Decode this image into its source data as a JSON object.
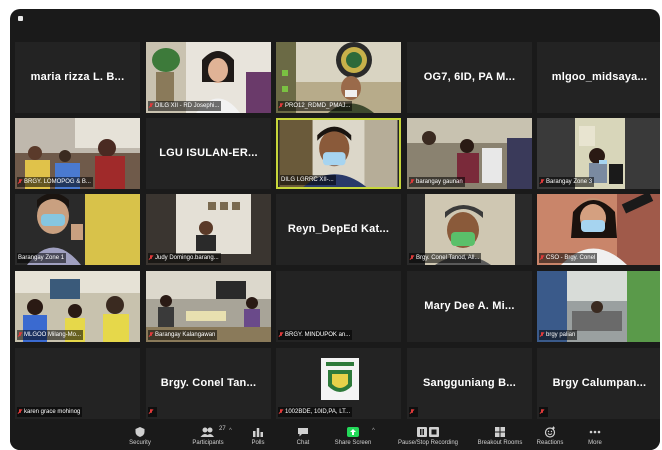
{
  "toolbar": {
    "security": "Security",
    "participants": "Participants",
    "participants_count": "27",
    "polls": "Polls",
    "chat": "Chat",
    "share_screen": "Share Screen",
    "stop_recording": "Pause/Stop Recording",
    "breakout": "Breakout Rooms",
    "reactions": "Reactions",
    "more": "More"
  },
  "tiles": [
    {
      "name": "maria rizza L. B...",
      "label": ""
    },
    {
      "name": "",
      "label": "DILG XII - RD Josephi..."
    },
    {
      "name": "",
      "label": "PRO12_RDMD_PMAJ..."
    },
    {
      "name": "OG7, 6ID, PA M...",
      "label": ""
    },
    {
      "name": "mlgoo_midsaya...",
      "label": ""
    },
    {
      "name": "",
      "label": "BRGY. LOMOPOG & B..."
    },
    {
      "name": "LGU ISULAN-ER...",
      "label": ""
    },
    {
      "name": "",
      "label": "DILG LGRRC XII-..."
    },
    {
      "name": "",
      "label": "barangay gaunan"
    },
    {
      "name": "",
      "label": "Barangay Zone 3"
    },
    {
      "name": "",
      "label": "Barangay Zone 1"
    },
    {
      "name": "",
      "label": "Judy Domingo.barang..."
    },
    {
      "name": "Reyn_DepEd Kat...",
      "label": ""
    },
    {
      "name": "",
      "label": "Brgy. Conel Tanod, All..."
    },
    {
      "name": "",
      "label": "CSO - Brgy. Conel"
    },
    {
      "name": "",
      "label": "MLGOO Milang-Mo..."
    },
    {
      "name": "",
      "label": "Barangay Kalangawan"
    },
    {
      "name": "",
      "label": "BRGY. MINDUPOK an..."
    },
    {
      "name": "Mary Dee A. Mi...",
      "label": ""
    },
    {
      "name": "",
      "label": "brgy palian"
    },
    {
      "name": "",
      "label": "karen grace mohinog"
    },
    {
      "name": "Brgy. Conel Tan...",
      "label": ""
    },
    {
      "name": "",
      "label": "1002BDE, 10ID,PA, LT..."
    },
    {
      "name": "Sangguniang B...",
      "label": ""
    },
    {
      "name": "Brgy Calumpan...",
      "label": ""
    }
  ]
}
